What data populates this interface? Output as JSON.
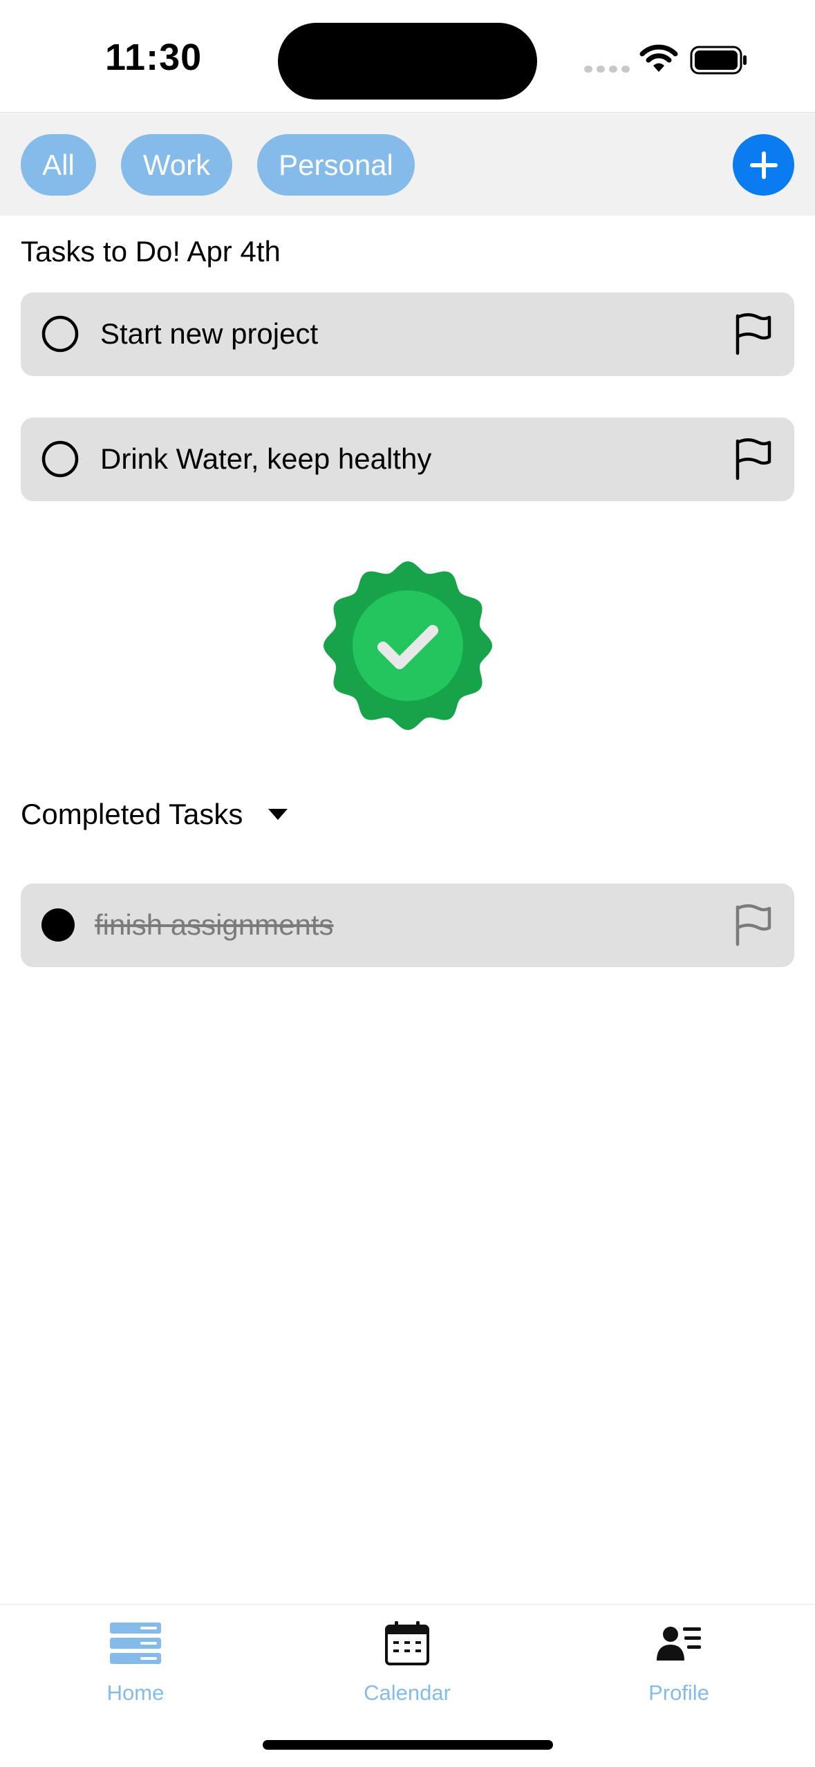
{
  "status_bar": {
    "time": "11:30"
  },
  "filters": {
    "chips": [
      {
        "label": "All"
      },
      {
        "label": "Work"
      },
      {
        "label": "Personal"
      }
    ],
    "add_icon": "plus-icon"
  },
  "main": {
    "title": "Tasks to Do! Apr 4th",
    "tasks": [
      {
        "label": "Start new project",
        "done": false,
        "icon": "flag-icon"
      },
      {
        "label": "Drink Water, keep healthy",
        "done": false,
        "icon": "flag-icon"
      }
    ],
    "badge_icon": "verified-badge-icon",
    "completed_header": "Completed Tasks",
    "completed": [
      {
        "label": "finish assignments",
        "done": true,
        "icon": "flag-icon"
      }
    ]
  },
  "tab_bar": {
    "tabs": [
      {
        "label": "Home",
        "icon": "home-stack-icon"
      },
      {
        "label": "Calendar",
        "icon": "calendar-icon"
      },
      {
        "label": "Profile",
        "icon": "profile-list-icon"
      }
    ]
  },
  "colors": {
    "accent": "#0a7cf0",
    "chip": "#84bbe9",
    "card": "#e0e0e0",
    "badge_outer": "#16a34a",
    "badge_inner": "#22c55e"
  }
}
